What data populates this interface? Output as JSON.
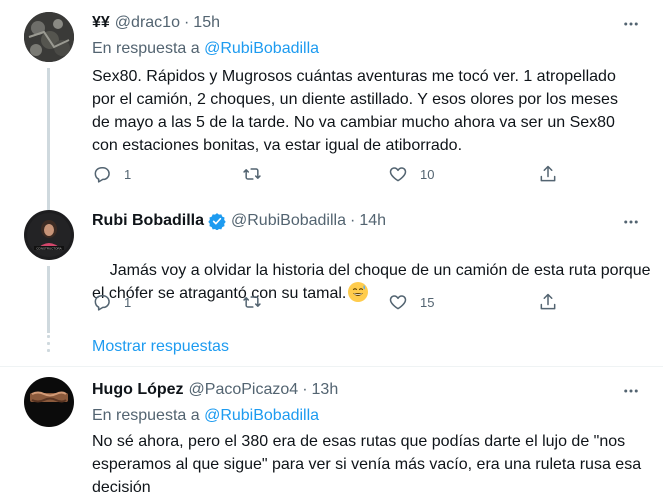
{
  "tweets": [
    {
      "name": "¥¥",
      "handle": "@drac1o",
      "sep": "·",
      "time": "15h",
      "reply_prefix": "En respuesta a",
      "reply_mention": "@RubiBobadilla",
      "text": "Sex80. Rápidos y Mugrosos cuántas aventuras me tocó ver. 1 atropellado\npor el camión, 2 choques, un diente astillado. Y esos olores por los meses\nde mayo a las 5 de la tarde. No va cambiar mucho ahora va ser un Sex80\ncon estaciones bonitas, va estar igual de atiborrado.",
      "replies": "1",
      "retweets": "",
      "likes": "10"
    },
    {
      "name": "Rubi Bobadilla",
      "handle": "@RubiBobadilla",
      "sep": "·",
      "time": "14h",
      "text": "Jamás voy a olvidar la historia del choque de un camión de esta ruta porque\nel chófer se atragantó con su tamal.",
      "replies": "1",
      "retweets": "",
      "likes": "15"
    },
    {
      "name": "Hugo López",
      "handle": "@PacoPicazo4",
      "sep": "·",
      "time": "13h",
      "reply_prefix": "En respuesta a",
      "reply_mention": "@RubiBobadilla",
      "text": "No sé ahora, pero el 380 era de esas rutas que podías darte el lujo de \"nos\nesperamos al que sigue\" para ver si venía más vacío, era una ruleta rusa esa\ndecisión"
    }
  ],
  "show_more_replies": "Mostrar respuestas",
  "colors": {
    "accent": "#1d9bf0",
    "secondary_text": "#536471",
    "primary_text": "#0f1419",
    "thread_line": "#cfd9de"
  },
  "icons": [
    "more-icon",
    "reply-icon",
    "retweet-icon",
    "like-icon",
    "share-icon",
    "verified-badge-icon",
    "grinning-sweat-emoji"
  ]
}
